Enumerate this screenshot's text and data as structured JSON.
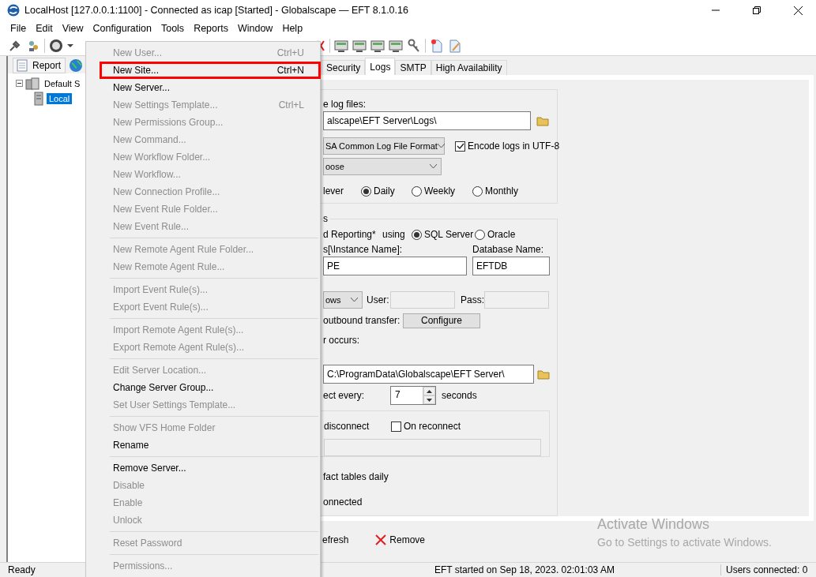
{
  "window": {
    "title": "LocalHost [127.0.0.1:1100] - Connected as icap [Started] - Globalscape — EFT 8.1.0.16"
  },
  "menu_bar": [
    "File",
    "Edit",
    "View",
    "Configuration",
    "Tools",
    "Reports",
    "Window",
    "Help"
  ],
  "left_tabs": [
    "Report"
  ],
  "tree": [
    {
      "label": "Default S",
      "expanded": true,
      "selected": false,
      "children": [
        {
          "label": "Local",
          "selected": true
        }
      ]
    }
  ],
  "tabs": [
    {
      "label": "Security",
      "selected": false
    },
    {
      "label": "Logs",
      "selected": true
    },
    {
      "label": "SMTP",
      "selected": false
    },
    {
      "label": "High Availability",
      "selected": false
    }
  ],
  "log_group": {
    "location_label": "e log files:",
    "location_value": "alscape\\EFT Server\\Logs\\",
    "format_value": "SA Common Log File Format",
    "encode_utf8": {
      "label": "Encode logs in UTF-8",
      "checked": true
    },
    "type_value": "oose",
    "rotation": [
      {
        "label": "lever"
      },
      {
        "label": "Daily",
        "selected": true
      },
      {
        "label": "Weekly",
        "selected": false
      },
      {
        "label": "Monthly",
        "selected": false
      }
    ]
  },
  "reporting_group": {
    "title": "s",
    "enable_label": "d Reporting*",
    "using_label": "using",
    "db_types": [
      {
        "label": "SQL Server",
        "selected": true
      },
      {
        "label": "Oracle",
        "selected": false
      }
    ],
    "server_label": "s[\\Instance Name]:",
    "database_label": "Database Name:",
    "server_value": "PE",
    "database_value": "EFTDB",
    "auth_value": "ows",
    "user_label": "User:",
    "pass_label": "Pass:",
    "credentials_disabled": true,
    "outbound_label": "outbound transfer:",
    "configure_button": "Configure",
    "error_label": "r occurs:",
    "error_path": "C:\\ProgramData\\Globalscape\\EFT Server\\",
    "reconnect_label": "ect every:",
    "reconnect_value": "7",
    "reconnect_unit": "seconds",
    "disconnect_label": "disconnect",
    "on_reconnect": {
      "label": "On reconnect",
      "checked": false
    },
    "purge_label": "fact tables daily",
    "connected_label": "onnected"
  },
  "bottom_actions": [
    {
      "label": "efresh",
      "kind": "refresh"
    },
    {
      "label": "Remove",
      "kind": "remove"
    }
  ],
  "status_bar": [
    "Ready",
    "EFT started on Sep 18, 2023. 02:01:03 AM",
    "Users connected: 0"
  ],
  "context_menu": [
    {
      "kind": "item",
      "label": "New User...",
      "shortcut": "Ctrl+U",
      "disabled": true,
      "selected": false
    },
    {
      "kind": "item",
      "label": "New Site...",
      "shortcut": "Ctrl+N",
      "disabled": false,
      "selected": true
    },
    {
      "kind": "item",
      "label": "New Server...",
      "disabled": false,
      "selected": false
    },
    {
      "kind": "item",
      "label": "New Settings Template...",
      "shortcut": "Ctrl+L",
      "disabled": true,
      "selected": false
    },
    {
      "kind": "item",
      "label": "New Permissions Group...",
      "disabled": true,
      "selected": false
    },
    {
      "kind": "item",
      "label": "New Command...",
      "disabled": true,
      "selected": false
    },
    {
      "kind": "item",
      "label": "New Workflow Folder...",
      "disabled": true,
      "selected": false
    },
    {
      "kind": "item",
      "label": "New Workflow...",
      "disabled": true,
      "selected": false
    },
    {
      "kind": "item",
      "label": "New Connection Profile...",
      "disabled": true,
      "selected": false
    },
    {
      "kind": "item",
      "label": "New Event Rule Folder...",
      "disabled": true,
      "selected": false
    },
    {
      "kind": "item",
      "label": "New Event Rule...",
      "disabled": true,
      "selected": false
    },
    {
      "kind": "separator"
    },
    {
      "kind": "item",
      "label": "New Remote Agent Rule Folder...",
      "disabled": true,
      "selected": false
    },
    {
      "kind": "item",
      "label": "New Remote Agent Rule...",
      "disabled": true,
      "selected": false
    },
    {
      "kind": "separator"
    },
    {
      "kind": "item",
      "label": "Import Event Rule(s)...",
      "disabled": true,
      "selected": false
    },
    {
      "kind": "item",
      "label": "Export Event Rule(s)...",
      "disabled": true,
      "selected": false
    },
    {
      "kind": "separator"
    },
    {
      "kind": "item",
      "label": "Import Remote Agent Rule(s)...",
      "disabled": true,
      "selected": false
    },
    {
      "kind": "item",
      "label": "Export Remote Agent Rule(s)...",
      "disabled": true,
      "selected": false
    },
    {
      "kind": "separator"
    },
    {
      "kind": "item",
      "label": "Edit Server Location...",
      "disabled": true,
      "selected": false
    },
    {
      "kind": "item",
      "label": "Change Server Group...",
      "disabled": false,
      "selected": false
    },
    {
      "kind": "item",
      "label": "Set User Settings Template...",
      "disabled": true,
      "selected": false
    },
    {
      "kind": "separator"
    },
    {
      "kind": "item",
      "label": "Show VFS Home Folder",
      "disabled": true,
      "selected": false
    },
    {
      "kind": "item",
      "label": "Rename",
      "disabled": false,
      "selected": false
    },
    {
      "kind": "separator"
    },
    {
      "kind": "item",
      "label": "Remove Server...",
      "disabled": false,
      "selected": false
    },
    {
      "kind": "item",
      "label": "Disable",
      "disabled": true,
      "selected": false
    },
    {
      "kind": "item",
      "label": "Enable",
      "disabled": true,
      "selected": false
    },
    {
      "kind": "item",
      "label": "Unlock",
      "disabled": true,
      "selected": false
    },
    {
      "kind": "separator"
    },
    {
      "kind": "item",
      "label": "Reset Password",
      "disabled": true,
      "selected": false
    },
    {
      "kind": "separator"
    },
    {
      "kind": "item",
      "label": "Permissions...",
      "disabled": true,
      "selected": false
    }
  ],
  "os_overlay": {
    "title": "Activate Windows",
    "subtitle": "Go to Settings to activate Windows."
  }
}
